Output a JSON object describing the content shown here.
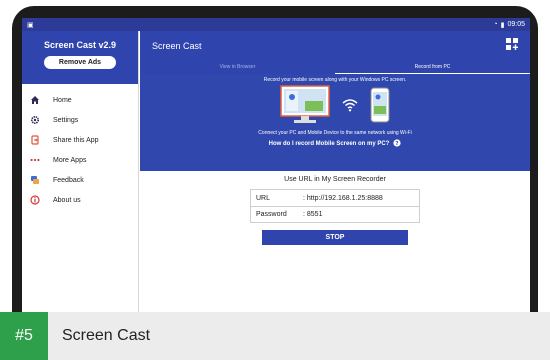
{
  "status_bar": {
    "time": "09:05"
  },
  "drawer": {
    "title": "Screen Cast v2.9",
    "remove_ads_label": "Remove Ads",
    "items": [
      {
        "label": "Home",
        "icon": "home-icon"
      },
      {
        "label": "Settings",
        "icon": "gear-icon"
      },
      {
        "label": "Share this App",
        "icon": "share-icon"
      },
      {
        "label": "More Apps",
        "icon": "more-dots-icon"
      },
      {
        "label": "Feedback",
        "icon": "feedback-icon"
      },
      {
        "label": "About us",
        "icon": "info-icon"
      }
    ]
  },
  "app_bar": {
    "title": "Screen Cast"
  },
  "tabs": [
    {
      "label": "View in Browser",
      "active": false
    },
    {
      "label": "Record from PC",
      "active": true
    }
  ],
  "banner": {
    "line1": "Record your mobile screen along with your Windows PC screen.",
    "line2": "Connect your PC and Mobile Device to the same network using Wi-Fi",
    "question": "How do I record Mobile Screen on my PC?"
  },
  "content": {
    "title": "Use URL in My Screen Recorder",
    "rows": [
      {
        "key": "URL",
        "value": ": http://192.168.1.25:8888"
      },
      {
        "key": "Password",
        "value": ": 8551"
      }
    ],
    "stop_label": "STOP"
  },
  "footer": {
    "rank": "#5",
    "app_name": "Screen Cast"
  },
  "colors": {
    "primary": "#2f44ad",
    "badge": "#2e9f4a"
  }
}
